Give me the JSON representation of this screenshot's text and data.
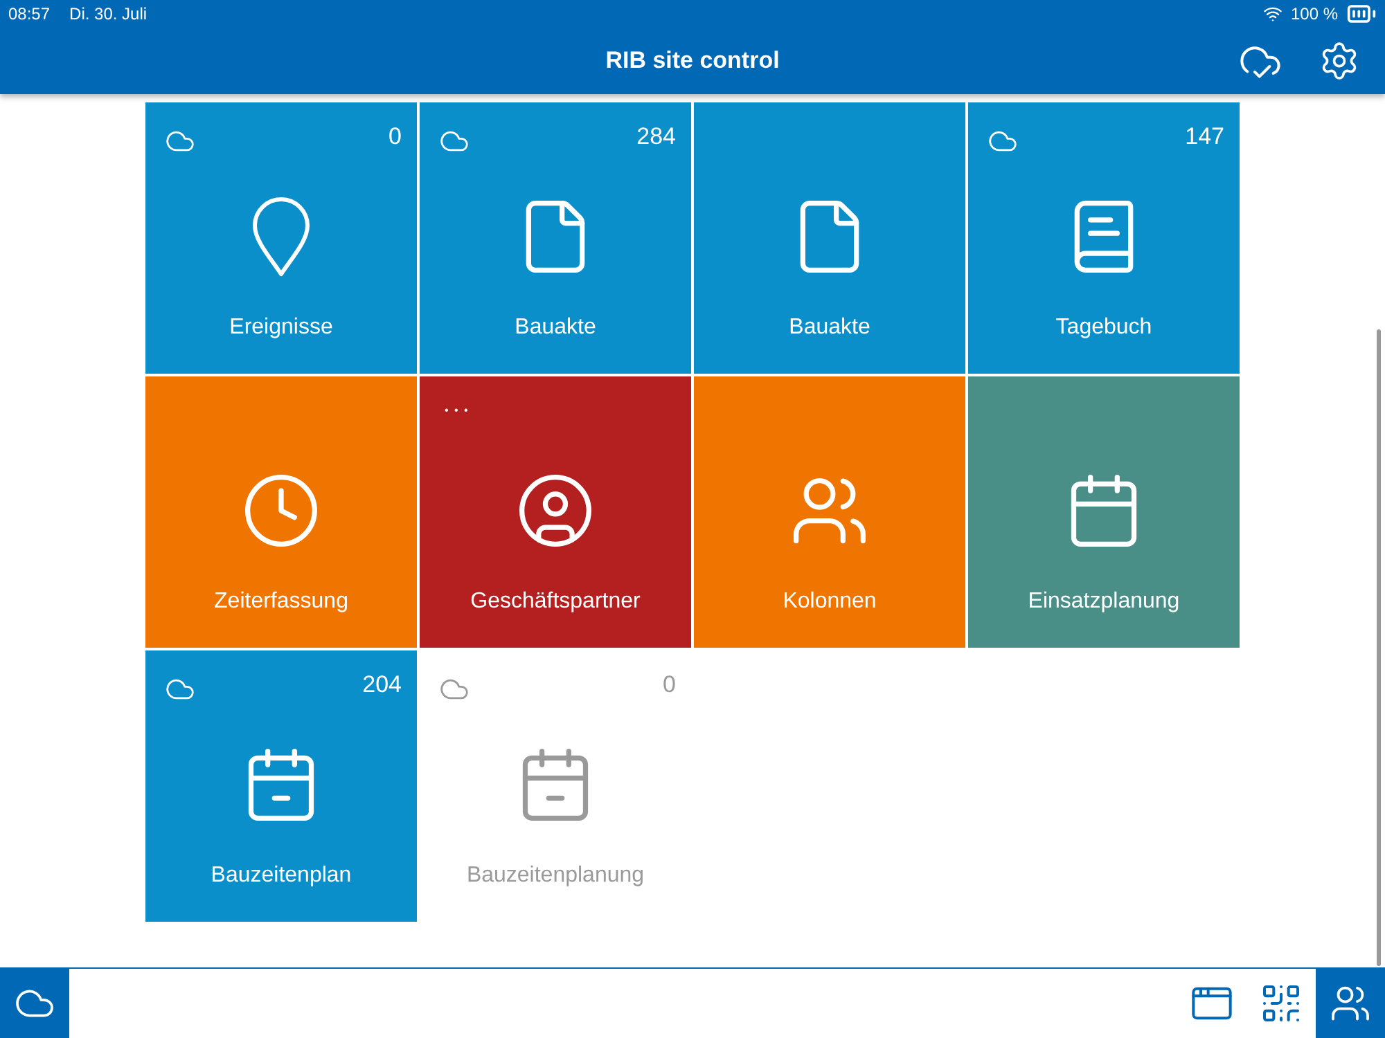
{
  "status_bar": {
    "time": "08:57",
    "date": "Di. 30. Juli",
    "battery": "100 %"
  },
  "nav_bar": {
    "title": "RIB site control"
  },
  "tiles": [
    {
      "label": "Ereignisse",
      "kind": "pin",
      "count": "0",
      "cloud": true,
      "color": "#0a8fcb",
      "disabled": false
    },
    {
      "label": "Bauakte",
      "kind": "document",
      "count": "284",
      "cloud": true,
      "color": "#0a8fcb",
      "disabled": false
    },
    {
      "label": "Bauakte",
      "kind": "document",
      "cloud": false,
      "color": "#0a8fcb",
      "disabled": false
    },
    {
      "label": "Tagebuch",
      "kind": "book",
      "count": "147",
      "cloud": true,
      "color": "#0a8fcb",
      "disabled": false
    },
    {
      "label": "Zeiterfassung",
      "kind": "clock",
      "cloud": false,
      "color": "#f07400",
      "disabled": false
    },
    {
      "label": "Geschäftspartner",
      "kind": "user",
      "badge": "• • •",
      "cloud": false,
      "color": "#b41f1f",
      "disabled": false
    },
    {
      "label": "Kolonnen",
      "kind": "users",
      "cloud": false,
      "color": "#f07400",
      "disabled": false
    },
    {
      "label": "Einsatzplanung",
      "kind": "calendar",
      "cloud": false,
      "color": "#4a8f87",
      "disabled": false
    },
    {
      "label": "Bauzeitenplan",
      "kind": "calendar-minus",
      "count": "204",
      "cloud": true,
      "color": "#0a8fcb",
      "disabled": false
    },
    {
      "label": "Bauzeitenplanung",
      "kind": "calendar-minus",
      "count": "0",
      "cloud": true,
      "color": "#ffffff",
      "disabled": true
    }
  ]
}
